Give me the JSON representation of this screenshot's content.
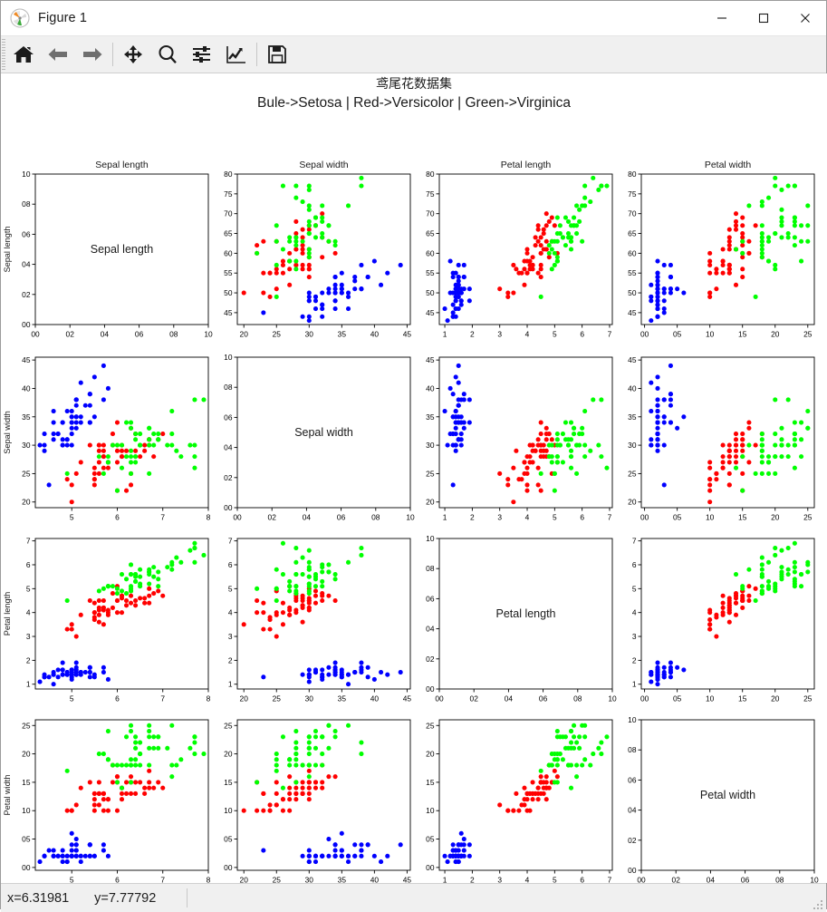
{
  "window": {
    "title": "Figure 1",
    "logo_icon": "matplotlib-logo-icon",
    "minimize_label": "─",
    "maximize_label": "□",
    "close_label": "✕"
  },
  "toolbar": {
    "buttons": [
      {
        "name": "home-button",
        "icon": "home-icon",
        "tooltip": "Reset original view"
      },
      {
        "name": "back-button",
        "icon": "arrow-left-icon",
        "tooltip": "Back to previous view"
      },
      {
        "name": "forward-button",
        "icon": "arrow-right-icon",
        "tooltip": "Forward to next view"
      },
      {
        "name": "pan-button",
        "icon": "move-arrows-icon",
        "tooltip": "Pan axes with left mouse, zoom with right"
      },
      {
        "name": "zoom-button",
        "icon": "magnifier-icon",
        "tooltip": "Zoom to rectangle"
      },
      {
        "name": "configure-subplots-button",
        "icon": "sliders-icon",
        "tooltip": "Configure subplots"
      },
      {
        "name": "edit-curves-button",
        "icon": "line-chart-icon",
        "tooltip": "Edit axis, curve and image parameters"
      },
      {
        "name": "save-button",
        "icon": "floppy-disk-icon",
        "tooltip": "Save the figure"
      }
    ]
  },
  "statusbar": {
    "x_readout": "x=6.31981",
    "y_readout": "y=7.77792",
    "grip_icon": "resize-grip-icon"
  },
  "figure": {
    "suptitle_line1": "鸢尾花数据集",
    "suptitle_line2": "Bule->Setosa | Red->Versicolor | Green->Virginica"
  },
  "chart_data": {
    "type": "scatter",
    "title": "鸢尾花数据集",
    "subtitle": "Bule->Setosa | Red->Versicolor | Green->Virginica",
    "layout": "4x4 scatter plot matrix (pairplot)",
    "grid": false,
    "legend_position": "in-title",
    "features": [
      "Sepal length",
      "Sepal width",
      "Petal length",
      "Petal width"
    ],
    "column_titles": [
      "Sepal length",
      "Sepal width",
      "Petal length",
      "Petal width"
    ],
    "row_ylabels": [
      "Sepal length",
      "Sepal width",
      "Petal length",
      "Petal width"
    ],
    "diagonal_labels": [
      "Sepal length",
      "Sepal width",
      "Petal length",
      "Petal width"
    ],
    "classes": [
      {
        "name": "Setosa",
        "color": "#0000FF",
        "legend": "Bule->Setosa"
      },
      {
        "name": "Versicolor",
        "color": "#FF0000",
        "legend": "Red->Versicolor"
      },
      {
        "name": "Virginica",
        "color": "#00FF00",
        "legend": "Green->Virginica"
      }
    ],
    "axis_ranges": {
      "Sepal length": [
        4.2,
        8.0
      ],
      "Sepal width": [
        1.9,
        4.55
      ],
      "Petal length": [
        0.8,
        7.1
      ],
      "Petal width": [
        -0.05,
        2.6
      ]
    },
    "axis_ticks": {
      "Sepal length": [
        5,
        6,
        7,
        8
      ],
      "Sepal width": [
        2.0,
        2.5,
        3.0,
        3.5,
        4.0,
        4.5
      ],
      "Petal length": [
        1,
        2,
        3,
        4,
        5,
        6,
        7
      ],
      "Petal width": [
        0.0,
        0.5,
        1.0,
        1.5,
        2.0,
        2.5
      ]
    },
    "axis_tick_labels": {
      "Sepal length": [
        "5",
        "6",
        "7",
        "8"
      ],
      "Sepal width": [
        "20",
        "25",
        "30",
        "35",
        "40",
        "45"
      ],
      "Petal length": [
        "1",
        "2",
        "3",
        "4",
        "5",
        "6",
        "7"
      ],
      "Petal width": [
        "00",
        "05",
        "10",
        "15",
        "20",
        "25"
      ]
    },
    "axis_tick_labels_y": {
      "Sepal length": [
        "45",
        "50",
        "55",
        "60",
        "65",
        "70",
        "75",
        "80"
      ],
      "Sepal width": [
        "20",
        "25",
        "30",
        "35",
        "40",
        "45"
      ],
      "Petal length": [
        "1",
        "2",
        "3",
        "4",
        "5",
        "6",
        "7"
      ],
      "Petal width": [
        "00",
        "05",
        "10",
        "15",
        "20",
        "25"
      ]
    },
    "y_ticks": {
      "Sepal length": [
        4.5,
        5.0,
        5.5,
        6.0,
        6.5,
        7.0,
        7.5,
        8.0
      ],
      "Sepal width": [
        2.0,
        2.5,
        3.0,
        3.5,
        4.0,
        4.5
      ],
      "Petal length": [
        1,
        2,
        3,
        4,
        5,
        6,
        7
      ],
      "Petal width": [
        0.0,
        0.5,
        1.0,
        1.5,
        2.0,
        2.5
      ]
    },
    "diagonal_panel_axis": {
      "range": [
        0.0,
        1.0
      ],
      "ticks": [
        0.0,
        0.2,
        0.4,
        0.6,
        0.8,
        1.0
      ],
      "tick_labels": [
        "00",
        "02",
        "04",
        "06",
        "08",
        "10"
      ]
    },
    "n_points": 150,
    "iris_columns": [
      "sepal_length",
      "sepal_width",
      "petal_length",
      "petal_width",
      "class"
    ],
    "iris": [
      [
        5.1,
        3.5,
        1.4,
        0.2,
        0
      ],
      [
        4.9,
        3.0,
        1.4,
        0.2,
        0
      ],
      [
        4.7,
        3.2,
        1.3,
        0.2,
        0
      ],
      [
        4.6,
        3.1,
        1.5,
        0.2,
        0
      ],
      [
        5.0,
        3.6,
        1.4,
        0.2,
        0
      ],
      [
        5.4,
        3.9,
        1.7,
        0.4,
        0
      ],
      [
        4.6,
        3.4,
        1.4,
        0.3,
        0
      ],
      [
        5.0,
        3.4,
        1.5,
        0.2,
        0
      ],
      [
        4.4,
        2.9,
        1.4,
        0.2,
        0
      ],
      [
        4.9,
        3.1,
        1.5,
        0.1,
        0
      ],
      [
        5.4,
        3.7,
        1.5,
        0.2,
        0
      ],
      [
        4.8,
        3.4,
        1.6,
        0.2,
        0
      ],
      [
        4.8,
        3.0,
        1.4,
        0.1,
        0
      ],
      [
        4.3,
        3.0,
        1.1,
        0.1,
        0
      ],
      [
        5.8,
        4.0,
        1.2,
        0.2,
        0
      ],
      [
        5.7,
        4.4,
        1.5,
        0.4,
        0
      ],
      [
        5.4,
        3.9,
        1.3,
        0.4,
        0
      ],
      [
        5.1,
        3.5,
        1.4,
        0.3,
        0
      ],
      [
        5.7,
        3.8,
        1.7,
        0.3,
        0
      ],
      [
        5.1,
        3.8,
        1.5,
        0.3,
        0
      ],
      [
        5.4,
        3.4,
        1.7,
        0.2,
        0
      ],
      [
        5.1,
        3.7,
        1.5,
        0.4,
        0
      ],
      [
        4.6,
        3.6,
        1.0,
        0.2,
        0
      ],
      [
        5.1,
        3.3,
        1.7,
        0.5,
        0
      ],
      [
        4.8,
        3.4,
        1.9,
        0.2,
        0
      ],
      [
        5.0,
        3.0,
        1.6,
        0.2,
        0
      ],
      [
        5.0,
        3.4,
        1.6,
        0.4,
        0
      ],
      [
        5.2,
        3.5,
        1.5,
        0.2,
        0
      ],
      [
        5.2,
        3.4,
        1.4,
        0.2,
        0
      ],
      [
        4.7,
        3.2,
        1.6,
        0.2,
        0
      ],
      [
        4.8,
        3.1,
        1.6,
        0.2,
        0
      ],
      [
        5.4,
        3.4,
        1.5,
        0.4,
        0
      ],
      [
        5.2,
        4.1,
        1.5,
        0.1,
        0
      ],
      [
        5.5,
        4.2,
        1.4,
        0.2,
        0
      ],
      [
        4.9,
        3.1,
        1.5,
        0.2,
        0
      ],
      [
        5.0,
        3.2,
        1.2,
        0.2,
        0
      ],
      [
        5.5,
        3.5,
        1.3,
        0.2,
        0
      ],
      [
        4.9,
        3.6,
        1.4,
        0.1,
        0
      ],
      [
        4.4,
        3.0,
        1.3,
        0.2,
        0
      ],
      [
        5.1,
        3.4,
        1.5,
        0.2,
        0
      ],
      [
        5.0,
        3.5,
        1.3,
        0.3,
        0
      ],
      [
        4.5,
        2.3,
        1.3,
        0.3,
        0
      ],
      [
        4.4,
        3.2,
        1.3,
        0.2,
        0
      ],
      [
        5.0,
        3.5,
        1.6,
        0.6,
        0
      ],
      [
        5.1,
        3.8,
        1.9,
        0.4,
        0
      ],
      [
        4.8,
        3.0,
        1.4,
        0.3,
        0
      ],
      [
        5.1,
        3.8,
        1.6,
        0.2,
        0
      ],
      [
        4.6,
        3.2,
        1.4,
        0.2,
        0
      ],
      [
        5.3,
        3.7,
        1.5,
        0.2,
        0
      ],
      [
        5.0,
        3.3,
        1.4,
        0.2,
        0
      ],
      [
        7.0,
        3.2,
        4.7,
        1.4,
        1
      ],
      [
        6.4,
        3.2,
        4.5,
        1.5,
        1
      ],
      [
        6.9,
        3.1,
        4.9,
        1.5,
        1
      ],
      [
        5.5,
        2.3,
        4.0,
        1.3,
        1
      ],
      [
        6.5,
        2.8,
        4.6,
        1.5,
        1
      ],
      [
        5.7,
        2.8,
        4.5,
        1.3,
        1
      ],
      [
        6.3,
        3.3,
        4.7,
        1.6,
        1
      ],
      [
        4.9,
        2.4,
        3.3,
        1.0,
        1
      ],
      [
        6.6,
        2.9,
        4.6,
        1.3,
        1
      ],
      [
        5.2,
        2.7,
        3.9,
        1.4,
        1
      ],
      [
        5.0,
        2.0,
        3.5,
        1.0,
        1
      ],
      [
        5.9,
        3.0,
        4.2,
        1.5,
        1
      ],
      [
        6.0,
        2.2,
        4.0,
        1.0,
        1
      ],
      [
        6.1,
        2.9,
        4.7,
        1.4,
        1
      ],
      [
        5.6,
        2.9,
        3.6,
        1.3,
        1
      ],
      [
        6.7,
        3.1,
        4.4,
        1.4,
        1
      ],
      [
        5.6,
        3.0,
        4.5,
        1.5,
        1
      ],
      [
        5.8,
        2.7,
        4.1,
        1.0,
        1
      ],
      [
        6.2,
        2.2,
        4.5,
        1.5,
        1
      ],
      [
        5.6,
        2.5,
        3.9,
        1.1,
        1
      ],
      [
        5.9,
        3.2,
        4.8,
        1.8,
        1
      ],
      [
        6.1,
        2.8,
        4.0,
        1.3,
        1
      ],
      [
        6.3,
        2.5,
        4.9,
        1.5,
        1
      ],
      [
        6.1,
        2.8,
        4.7,
        1.2,
        1
      ],
      [
        6.4,
        2.9,
        4.3,
        1.3,
        1
      ],
      [
        6.6,
        3.0,
        4.4,
        1.4,
        1
      ],
      [
        6.8,
        2.8,
        4.8,
        1.4,
        1
      ],
      [
        6.7,
        3.0,
        5.0,
        1.7,
        1
      ],
      [
        6.0,
        2.9,
        4.5,
        1.5,
        1
      ],
      [
        5.7,
        2.6,
        3.5,
        1.0,
        1
      ],
      [
        5.5,
        2.4,
        3.8,
        1.1,
        1
      ],
      [
        5.5,
        2.4,
        3.7,
        1.0,
        1
      ],
      [
        5.8,
        2.7,
        3.9,
        1.2,
        1
      ],
      [
        6.0,
        2.7,
        5.1,
        1.6,
        1
      ],
      [
        5.4,
        3.0,
        4.5,
        1.5,
        1
      ],
      [
        6.0,
        3.4,
        4.5,
        1.6,
        1
      ],
      [
        6.7,
        3.1,
        4.7,
        1.5,
        1
      ],
      [
        6.3,
        2.3,
        4.4,
        1.3,
        1
      ],
      [
        5.6,
        3.0,
        4.1,
        1.3,
        1
      ],
      [
        5.5,
        2.5,
        4.0,
        1.3,
        1
      ],
      [
        5.5,
        2.6,
        4.4,
        1.2,
        1
      ],
      [
        6.1,
        3.0,
        4.6,
        1.4,
        1
      ],
      [
        5.8,
        2.6,
        4.0,
        1.2,
        1
      ],
      [
        5.0,
        2.3,
        3.3,
        1.0,
        1
      ],
      [
        5.6,
        2.7,
        4.2,
        1.3,
        1
      ],
      [
        5.7,
        3.0,
        4.2,
        1.2,
        1
      ],
      [
        5.7,
        2.9,
        4.2,
        1.3,
        1
      ],
      [
        6.2,
        2.9,
        4.3,
        1.3,
        1
      ],
      [
        5.1,
        2.5,
        3.0,
        1.1,
        1
      ],
      [
        5.7,
        2.8,
        4.1,
        1.3,
        1
      ],
      [
        6.3,
        3.3,
        6.0,
        2.5,
        2
      ],
      [
        5.8,
        2.7,
        5.1,
        1.9,
        2
      ],
      [
        7.1,
        3.0,
        5.9,
        2.1,
        2
      ],
      [
        6.3,
        2.9,
        5.6,
        1.8,
        2
      ],
      [
        6.5,
        3.0,
        5.8,
        2.2,
        2
      ],
      [
        7.6,
        3.0,
        6.6,
        2.1,
        2
      ],
      [
        4.9,
        2.5,
        4.5,
        1.7,
        2
      ],
      [
        7.3,
        2.9,
        6.3,
        1.8,
        2
      ],
      [
        6.7,
        2.5,
        5.8,
        1.8,
        2
      ],
      [
        7.2,
        3.6,
        6.1,
        2.5,
        2
      ],
      [
        6.5,
        3.2,
        5.1,
        2.0,
        2
      ],
      [
        6.4,
        2.7,
        5.3,
        1.9,
        2
      ],
      [
        6.8,
        3.0,
        5.5,
        2.1,
        2
      ],
      [
        5.7,
        2.5,
        5.0,
        2.0,
        2
      ],
      [
        5.8,
        2.8,
        5.1,
        2.4,
        2
      ],
      [
        6.4,
        3.2,
        5.3,
        2.3,
        2
      ],
      [
        6.5,
        3.0,
        5.5,
        1.8,
        2
      ],
      [
        7.7,
        3.8,
        6.7,
        2.2,
        2
      ],
      [
        7.7,
        2.6,
        6.9,
        2.3,
        2
      ],
      [
        6.0,
        2.2,
        5.0,
        1.5,
        2
      ],
      [
        6.9,
        3.2,
        5.7,
        2.3,
        2
      ],
      [
        5.6,
        2.8,
        4.9,
        2.0,
        2
      ],
      [
        7.7,
        2.8,
        6.7,
        2.0,
        2
      ],
      [
        6.3,
        2.7,
        4.9,
        1.8,
        2
      ],
      [
        6.7,
        3.3,
        5.7,
        2.1,
        2
      ],
      [
        7.2,
        3.2,
        6.0,
        1.8,
        2
      ],
      [
        6.2,
        2.8,
        4.8,
        1.8,
        2
      ],
      [
        6.1,
        3.0,
        4.9,
        1.8,
        2
      ],
      [
        6.4,
        2.8,
        5.6,
        2.1,
        2
      ],
      [
        7.2,
        3.0,
        5.8,
        1.6,
        2
      ],
      [
        7.4,
        2.8,
        6.1,
        1.9,
        2
      ],
      [
        7.9,
        3.8,
        6.4,
        2.0,
        2
      ],
      [
        6.4,
        2.8,
        5.6,
        2.2,
        2
      ],
      [
        6.3,
        2.8,
        5.1,
        1.5,
        2
      ],
      [
        6.1,
        2.6,
        5.6,
        1.4,
        2
      ],
      [
        7.7,
        3.0,
        6.1,
        2.3,
        2
      ],
      [
        6.3,
        3.4,
        5.6,
        2.4,
        2
      ],
      [
        6.4,
        3.1,
        5.5,
        1.8,
        2
      ],
      [
        6.0,
        3.0,
        4.8,
        1.8,
        2
      ],
      [
        6.9,
        3.1,
        5.4,
        2.1,
        2
      ],
      [
        6.7,
        3.1,
        5.6,
        2.4,
        2
      ],
      [
        6.9,
        3.1,
        5.1,
        2.3,
        2
      ],
      [
        5.8,
        2.7,
        5.1,
        1.9,
        2
      ],
      [
        6.8,
        3.2,
        5.9,
        2.3,
        2
      ],
      [
        6.7,
        3.3,
        5.7,
        2.5,
        2
      ],
      [
        6.7,
        3.0,
        5.2,
        2.3,
        2
      ],
      [
        6.3,
        2.5,
        5.0,
        1.9,
        2
      ],
      [
        6.5,
        3.0,
        5.2,
        2.0,
        2
      ],
      [
        6.2,
        3.4,
        5.4,
        2.3,
        2
      ],
      [
        5.9,
        3.0,
        5.1,
        1.8,
        2
      ]
    ]
  }
}
